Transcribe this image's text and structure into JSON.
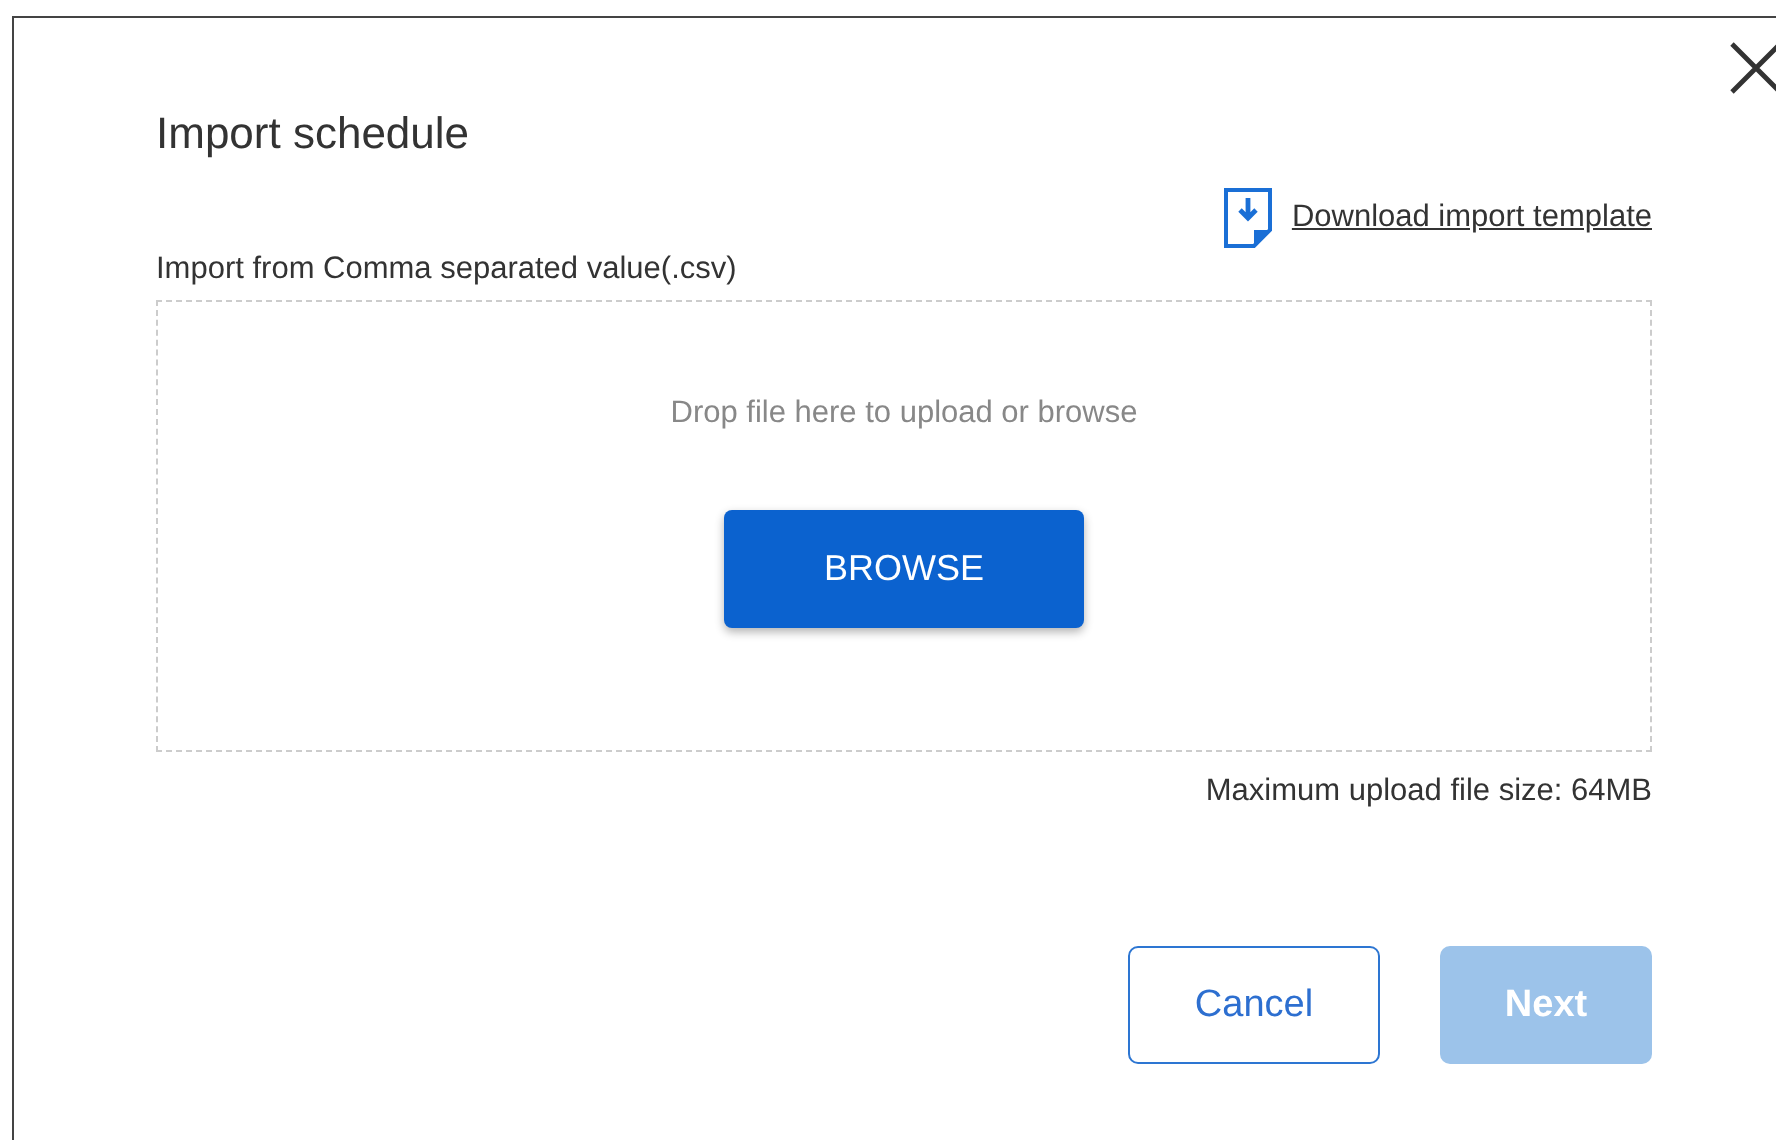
{
  "dialog": {
    "title": "Import schedule",
    "download_link": "Download import template",
    "source_label": "Import from Comma separated value(.csv)",
    "dropzone": {
      "hint": "Drop file here to upload or browse",
      "button": "BROWSE"
    },
    "size_note": "Maximum upload file size: 64MB",
    "buttons": [
      {
        "label": "Cancel",
        "kind": "secondary",
        "disabled": false
      },
      {
        "label": "Next",
        "kind": "primary",
        "disabled": true
      }
    ]
  }
}
